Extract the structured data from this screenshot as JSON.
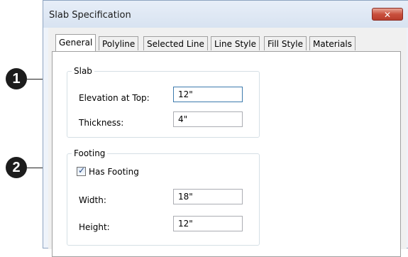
{
  "window": {
    "title": "Slab Specification",
    "close_glyph": "✕"
  },
  "tabs": [
    {
      "label": "General",
      "active": true
    },
    {
      "label": "Polyline"
    },
    {
      "label": "Selected Line"
    },
    {
      "label": "Line Style"
    },
    {
      "label": "Fill Style"
    },
    {
      "label": "Materials"
    }
  ],
  "slab": {
    "group_title": "Slab",
    "elevation_label": "Elevation at Top:",
    "elevation_value": "12\"",
    "thickness_label": "Thickness:",
    "thickness_value": "4\""
  },
  "footing": {
    "group_title": "Footing",
    "has_footing_label": "Has Footing",
    "has_footing_checked": true,
    "check_glyph": "✓",
    "width_label": "Width:",
    "width_value": "18\"",
    "height_label": "Height:",
    "height_value": "12\""
  },
  "callouts": [
    "1",
    "2"
  ]
}
